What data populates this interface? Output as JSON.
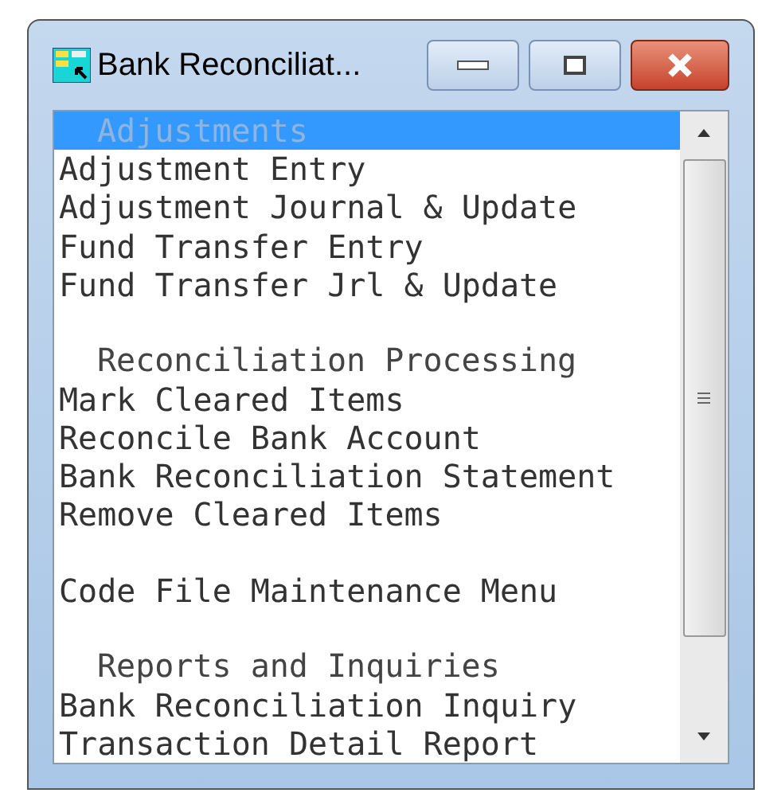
{
  "window": {
    "title": "Bank Reconciliat..."
  },
  "menu": [
    {
      "kind": "header",
      "label": "Adjustments",
      "selected": true
    },
    {
      "kind": "item",
      "label": "Adjustment Entry",
      "selected": false
    },
    {
      "kind": "item",
      "label": "Adjustment Journal & Update",
      "selected": false
    },
    {
      "kind": "item",
      "label": "Fund Transfer Entry",
      "selected": false
    },
    {
      "kind": "item",
      "label": "Fund Transfer Jrl & Update",
      "selected": false
    },
    {
      "kind": "spacer"
    },
    {
      "kind": "header",
      "label": "Reconciliation Processing",
      "selected": false
    },
    {
      "kind": "item",
      "label": "Mark Cleared Items",
      "selected": false
    },
    {
      "kind": "item",
      "label": "Reconcile Bank Account",
      "selected": false
    },
    {
      "kind": "item",
      "label": "Bank Reconciliation Statement",
      "selected": false
    },
    {
      "kind": "item",
      "label": "Remove Cleared Items",
      "selected": false
    },
    {
      "kind": "spacer"
    },
    {
      "kind": "item",
      "label": "Code File Maintenance Menu",
      "selected": false
    },
    {
      "kind": "spacer"
    },
    {
      "kind": "header",
      "label": "Reports and Inquiries",
      "selected": false
    },
    {
      "kind": "item",
      "label": "Bank Reconciliation Inquiry",
      "selected": false
    },
    {
      "kind": "item",
      "label": "Transaction Detail Report",
      "selected": false
    }
  ]
}
